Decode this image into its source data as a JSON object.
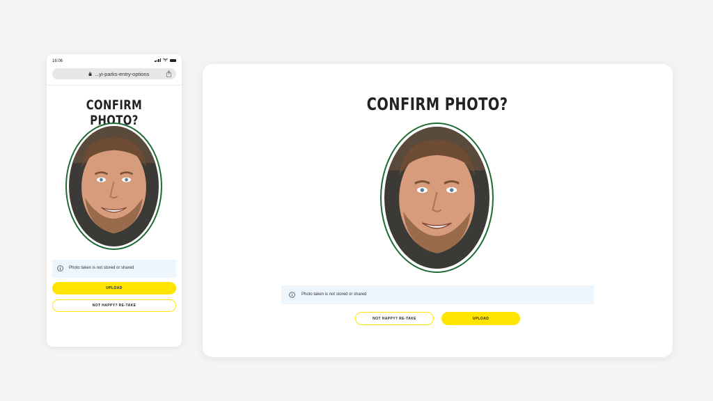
{
  "mobile": {
    "status_time": "16:06",
    "url": "...yi-parks-entry-options",
    "title": "CONFIRM PHOTO?",
    "notice": "Photo taken is not stored or shared",
    "upload_label": "UPLOAD",
    "retake_label": "NOT HAPPY? RE-TAKE"
  },
  "desktop": {
    "title": "CONFIRM PHOTO?",
    "notice": "Photo taken is not stored or shared",
    "retake_label": "NOT HAPPY? RE-TAKE",
    "upload_label": "UPLOAD"
  },
  "colors": {
    "accent_yellow": "#ffe500",
    "photo_ring_green": "#1e6a34",
    "notice_bg": "#eef6fd",
    "page_bg": "#f4f4f4"
  },
  "icons": [
    "signal-icon",
    "wifi-icon",
    "battery-icon",
    "lock-icon",
    "share-icon",
    "info-icon"
  ]
}
